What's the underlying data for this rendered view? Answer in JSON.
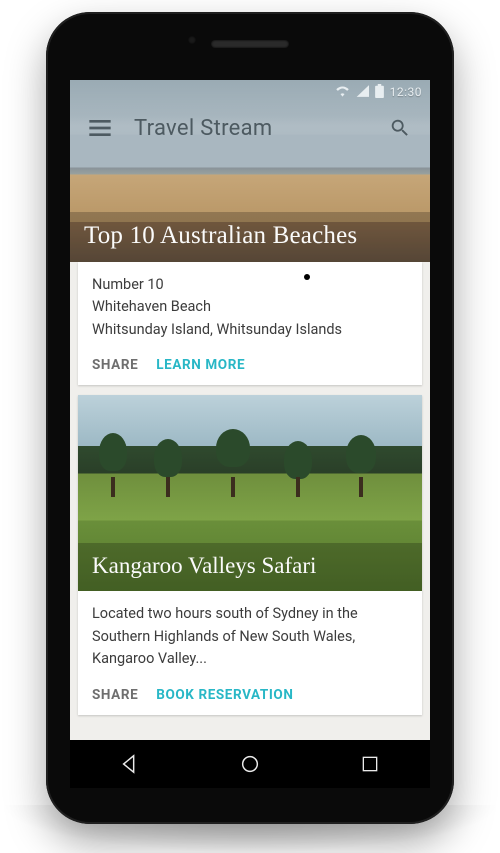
{
  "status": {
    "time": "12:30",
    "icons": {
      "wifi": "wifi-icon",
      "cell": "cell-icon",
      "battery": "battery-icon"
    }
  },
  "appbar": {
    "title": "Travel Stream"
  },
  "hero": {
    "title": "Top 10 Australian Beaches"
  },
  "cards": [
    {
      "line1": "Number 10",
      "line2": "Whitehaven Beach",
      "line3": "Whitsunday Island, Whitsunday Islands",
      "actions": {
        "primary": "SHARE",
        "secondary": "LEARN MORE"
      }
    },
    {
      "media_title": "Kangaroo Valleys Safari",
      "body": "Located two hours south of Sydney in the Southern Highlands of New South Wales, Kangaroo Valley...",
      "actions": {
        "primary": "SHARE",
        "secondary": "BOOK RESERVATION"
      }
    }
  ],
  "colors": {
    "accent": "#28b7c6"
  }
}
